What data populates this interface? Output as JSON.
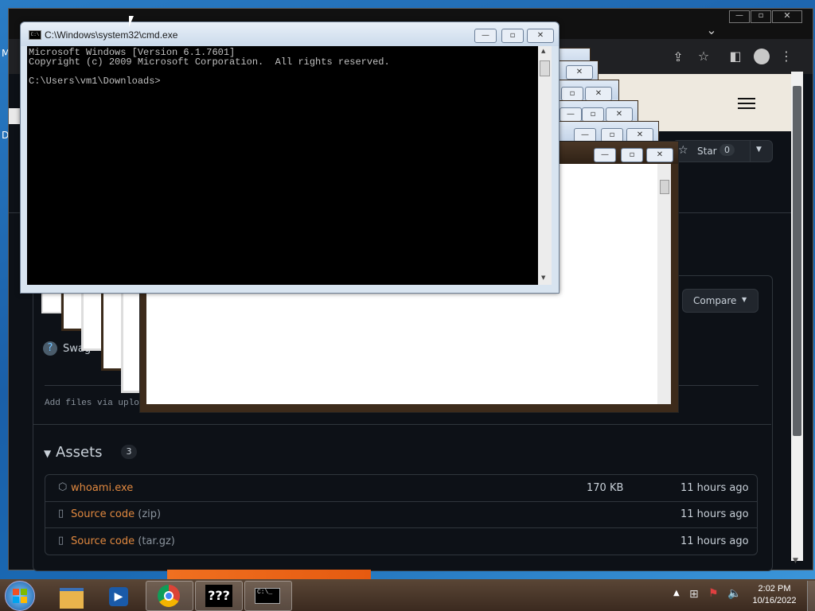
{
  "desktop": {
    "edge_labels": [
      "M",
      "D"
    ]
  },
  "browser": {
    "site": {
      "star_label": "Star",
      "star_count": "0",
      "compare_label": "Compare",
      "release_asset_hint": "Swag",
      "upload_hint": "Add files via uplo"
    },
    "assets": {
      "heading": "Assets",
      "count": "3",
      "rows": [
        {
          "name": "whoami.exe",
          "suffix": "",
          "size": "170 KB",
          "time": "11 hours ago",
          "icon": "package-icon"
        },
        {
          "name": "Source code",
          "suffix": " (zip)",
          "size": "",
          "time": "11 hours ago",
          "icon": "file-zip-icon"
        },
        {
          "name": "Source code",
          "suffix": " (tar.gz)",
          "size": "",
          "time": "11 hours ago",
          "icon": "file-zip-icon"
        }
      ]
    }
  },
  "cmd": {
    "title": "C:\\Windows\\system32\\cmd.exe",
    "lines": [
      "Microsoft Windows [Version 6.1.7601]",
      "Copyright (c) 2009 Microsoft Corporation.  All rights reserved.",
      "",
      "C:\\Users\\vm1\\Downloads>"
    ]
  },
  "taskbar": {
    "apps": [
      "explorer-icon",
      "media-player-icon",
      "chrome-icon",
      "unknown-app-icon",
      "cmd-icon"
    ],
    "unknown_app_label": "???",
    "cmd_icon_label": "C:\\_",
    "clock_time": "2:02 PM",
    "clock_date": "10/16/2022"
  },
  "colors": {
    "accent_link": "#e0883f",
    "github_bg": "#0d1117",
    "taskbar": "#4a3728"
  }
}
